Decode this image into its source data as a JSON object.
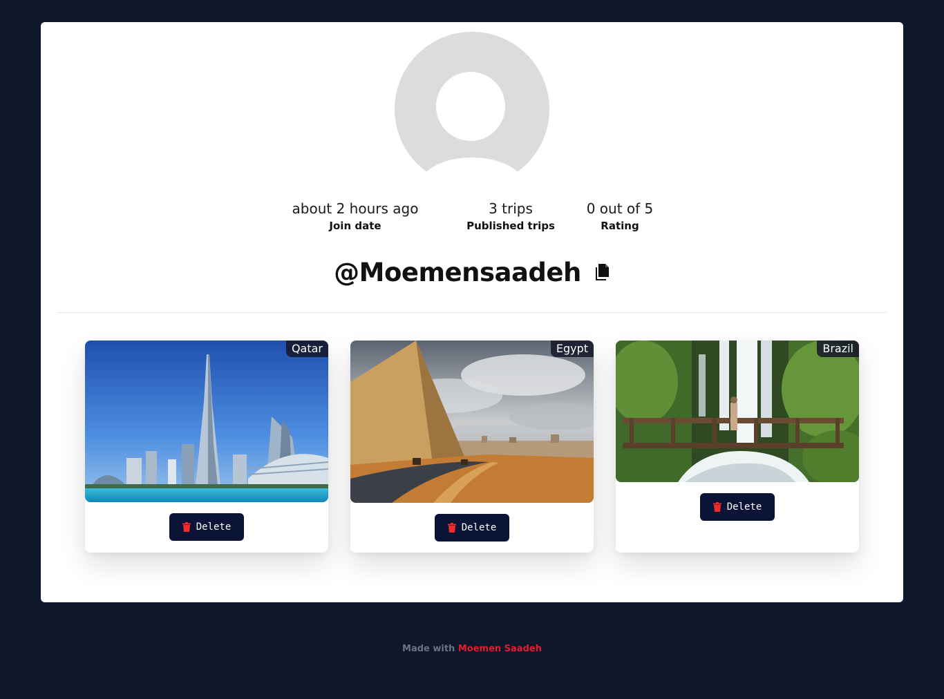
{
  "profile": {
    "join_date_value": "about 2 hours ago",
    "join_date_label": "Join date",
    "trips_value": "3 trips",
    "trips_label": "Published trips",
    "rating_value": "0 out of 5",
    "rating_label": "Rating",
    "username": "@Moemensaadeh"
  },
  "trips": [
    {
      "country": "Qatar",
      "delete_label": "Delete"
    },
    {
      "country": "Egypt",
      "delete_label": "Delete"
    },
    {
      "country": "Brazil",
      "delete_label": "Delete"
    }
  ],
  "footer": {
    "prefix": "Made with ",
    "author": "Moemen Saadeh"
  },
  "colors": {
    "page_bg": "#0f172a",
    "button_bg": "#0b1437",
    "accent_red": "#e11d2e"
  },
  "icons": {
    "avatar": "user-placeholder-icon",
    "copy": "copy-icon",
    "trash": "trash-icon"
  }
}
